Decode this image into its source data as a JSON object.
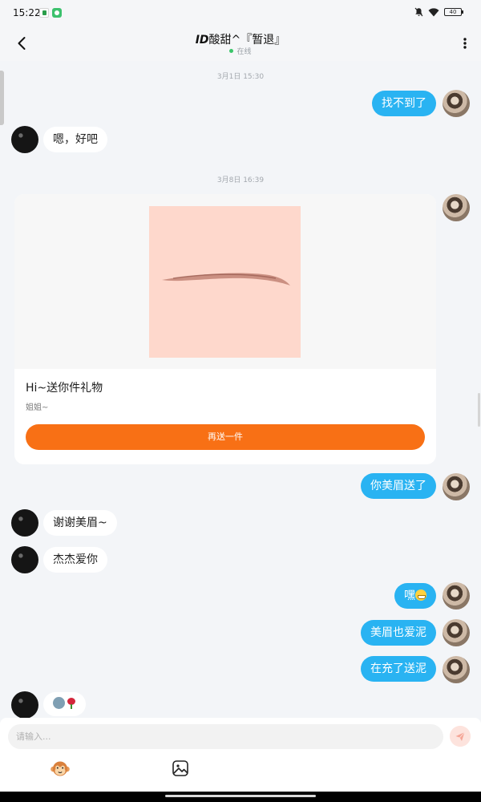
{
  "status_bar": {
    "time": "15:22",
    "battery": "40",
    "icons": [
      "app-icon",
      "chat-app-icon",
      "mute-icon",
      "wifi-icon",
      "battery-icon"
    ]
  },
  "header": {
    "title_prefix": "ID",
    "title_name": "酸甜^『暂退』",
    "status": "在线",
    "icons": [
      "back-arrow-icon",
      "more-vertical-icon"
    ]
  },
  "chat": {
    "timestamps": [
      "3月1日 15:30",
      "3月8日 16:39"
    ],
    "messages": [
      {
        "sender": "self",
        "text": "找不到了"
      },
      {
        "sender": "other",
        "text": "嗯，好吧"
      },
      {
        "sender": "self",
        "type": "gift",
        "title": "Hi~送你件礼物",
        "subtitle": "姐姐~",
        "button": "再送一件"
      },
      {
        "sender": "self",
        "text": "你美眉送了"
      },
      {
        "sender": "other",
        "text": "谢谢美眉~"
      },
      {
        "sender": "other",
        "text": "杰杰爱你"
      },
      {
        "sender": "self",
        "text": "嘿",
        "emoji": "grin-emoji"
      },
      {
        "sender": "self",
        "text": "美眉也爱泥"
      },
      {
        "sender": "self",
        "text": "在充了送泥"
      },
      {
        "sender": "other",
        "text": "",
        "emoji": [
          "blue-face-emoji",
          "rose-emoji"
        ]
      }
    ]
  },
  "input": {
    "placeholder": "请输入..."
  },
  "toolbar": {
    "icons": [
      "emoji-monkey-icon",
      "image-icon",
      "send-icon"
    ]
  },
  "colors": {
    "self_bubble": "#29b3f2",
    "gift_button": "#f87015",
    "online": "#3ac569",
    "background": "#f3f5f8"
  }
}
